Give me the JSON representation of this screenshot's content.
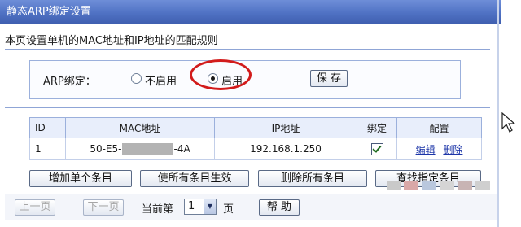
{
  "window": {
    "title": "静态ARP绑定设置"
  },
  "description": "本页设置单机的MAC地址和IP地址的匹配规则",
  "arp_binding": {
    "label": "ARP绑定：",
    "options": [
      {
        "label": "不启用",
        "checked": false
      },
      {
        "label": "启用",
        "checked": true
      }
    ],
    "save_label": "保 存",
    "highlight_color": "#d21b1b"
  },
  "table": {
    "headers": [
      "ID",
      "MAC地址",
      "IP地址",
      "绑定",
      "配置"
    ],
    "rows": [
      {
        "id": "1",
        "mac_prefix": "50-E5-",
        "mac_suffix": "-4A",
        "ip": "192.168.1.250",
        "bound": true,
        "actions": [
          "编辑",
          "删除"
        ]
      }
    ]
  },
  "actions": {
    "add_single": "增加单个条目",
    "enable_all": "使所有条目生效",
    "delete_all": "删除所有条目",
    "find_entry": "查找指定条目"
  },
  "pagination": {
    "prev_label": "上一页",
    "next_label": "下一页",
    "current_prefix": "当前第",
    "current_page": "1",
    "page_suffix": "页",
    "help_label": "帮 助"
  },
  "colors": {
    "title_bar": "#5072c4",
    "link": "#1c35a8",
    "border": "#9bb0dc"
  }
}
